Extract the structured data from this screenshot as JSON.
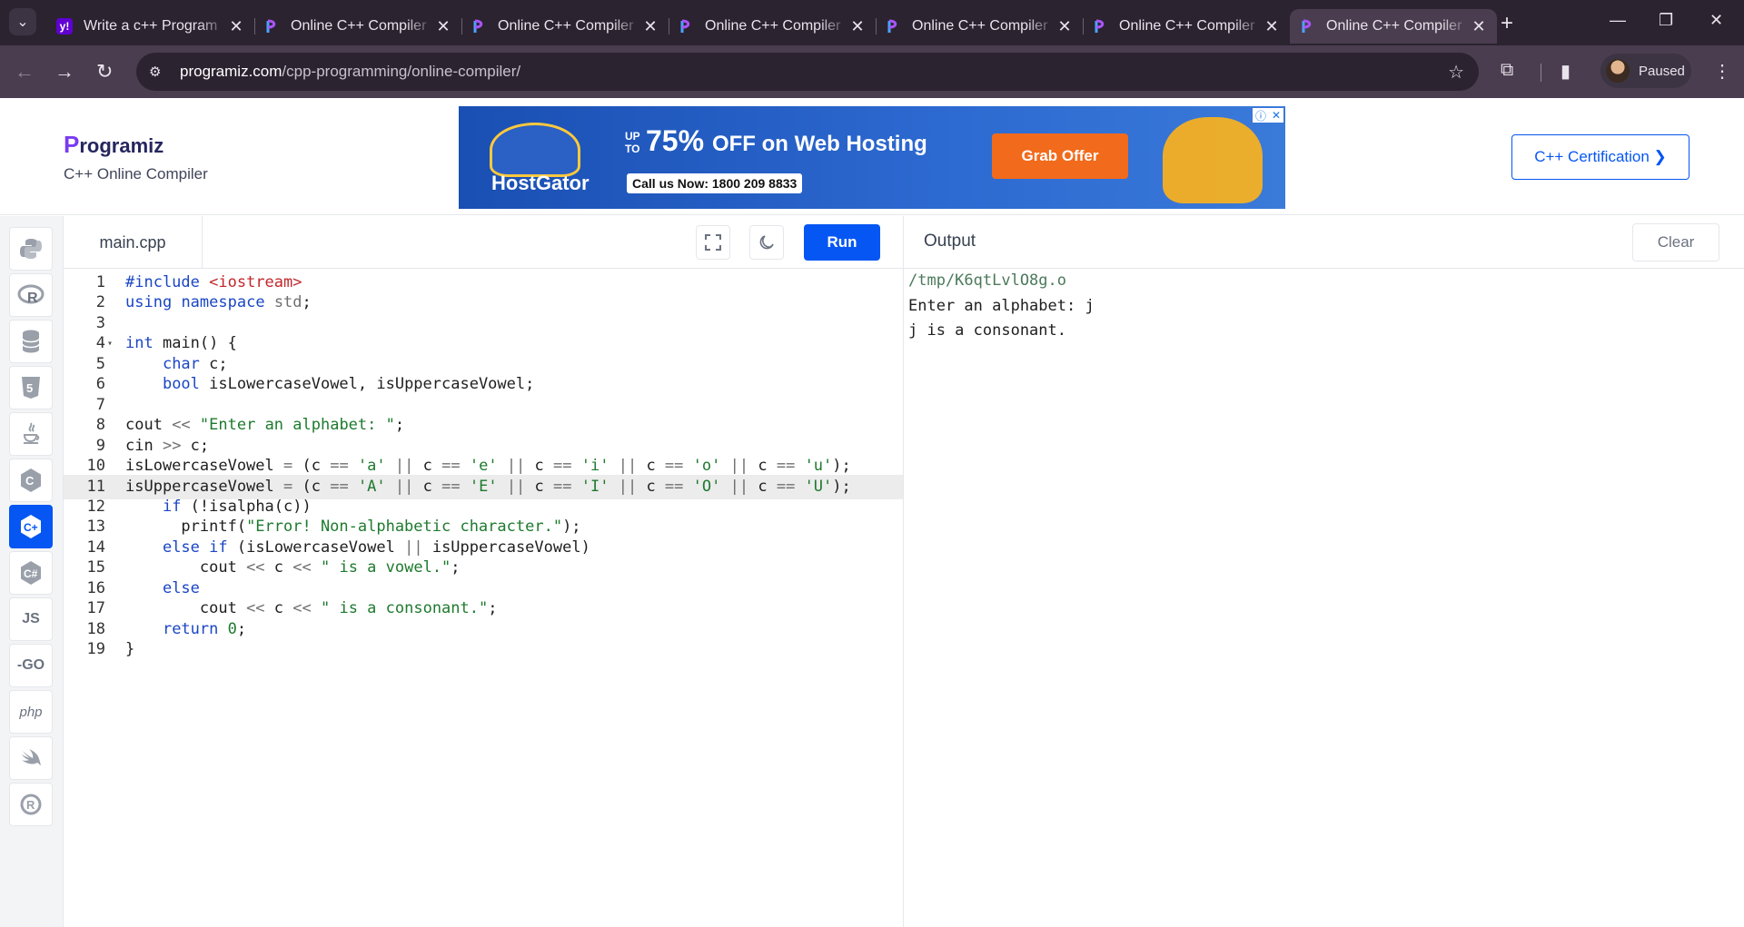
{
  "browser": {
    "tabs": [
      {
        "title": "Write a c++ Program",
        "favicon": "yahoo-icon",
        "active": false
      },
      {
        "title": "Online C++ Compiler",
        "favicon": "programiz-icon",
        "active": false
      },
      {
        "title": "Online C++ Compiler",
        "favicon": "programiz-icon",
        "active": false
      },
      {
        "title": "Online C++ Compiler",
        "favicon": "programiz-icon",
        "active": false
      },
      {
        "title": "Online C++ Compiler",
        "favicon": "programiz-icon",
        "active": false
      },
      {
        "title": "Online C++ Compiler",
        "favicon": "programiz-icon",
        "active": false
      },
      {
        "title": "Online C++ Compiler",
        "favicon": "programiz-icon",
        "active": true
      }
    ],
    "url_host": "programiz.com",
    "url_path": "/cpp-programming/online-compiler/",
    "profile_label": "Paused"
  },
  "header": {
    "logo_first": "P",
    "logo_rest": "rogramiz",
    "subtitle": "C++ Online Compiler",
    "cert_button": "C++ Certification ❯"
  },
  "ad": {
    "brand": "HostGator",
    "upto": "UP TO",
    "headline_pct": "75%",
    "headline_rest": "OFF on Web Hosting",
    "call": "Call us Now: 1800 209 8833",
    "cta": "Grab Offer"
  },
  "rail": [
    "python-icon",
    "r-icon",
    "sql-icon",
    "html5-icon",
    "java-icon",
    "c-icon",
    "cpp-icon",
    "csharp-icon",
    "js-icon",
    "go-icon",
    "php-icon",
    "swift-icon",
    "rust-icon"
  ],
  "rail_labels": {
    "js": "JS",
    "go": "-GO",
    "php": "php"
  },
  "editor": {
    "file_name": "main.cpp",
    "run_label": "Run",
    "lines": [
      "#include <iostream>",
      "using namespace std;",
      "",
      "int main() {",
      "    char c;",
      "    bool isLowercaseVowel, isUppercaseVowel;",
      "",
      "cout << \"Enter an alphabet: \";",
      "cin >> c;",
      "isLowercaseVowel = (c == 'a' || c == 'e' || c == 'i' || c == 'o' || c == 'u');",
      "isUppercaseVowel = (c == 'A' || c == 'E' || c == 'I' || c == 'O' || c == 'U');",
      "    if (!isalpha(c))",
      "      printf(\"Error! Non-alphabetic character.\");",
      "    else if (isLowercaseVowel || isUppercaseVowel)",
      "        cout << c << \" is a vowel.\";",
      "    else",
      "        cout << c << \" is a consonant.\";",
      "    return 0;",
      "}"
    ],
    "highlighted_line": 11
  },
  "output": {
    "title": "Output",
    "clear_label": "Clear",
    "lines": [
      "/tmp/K6qtLvlO8g.o",
      "Enter an alphabet: j",
      "j is a consonant."
    ]
  },
  "colors": {
    "accent": "#0556f3",
    "chrome_dark": "#2b2330",
    "chrome_toolbar": "#4a3d4f"
  }
}
